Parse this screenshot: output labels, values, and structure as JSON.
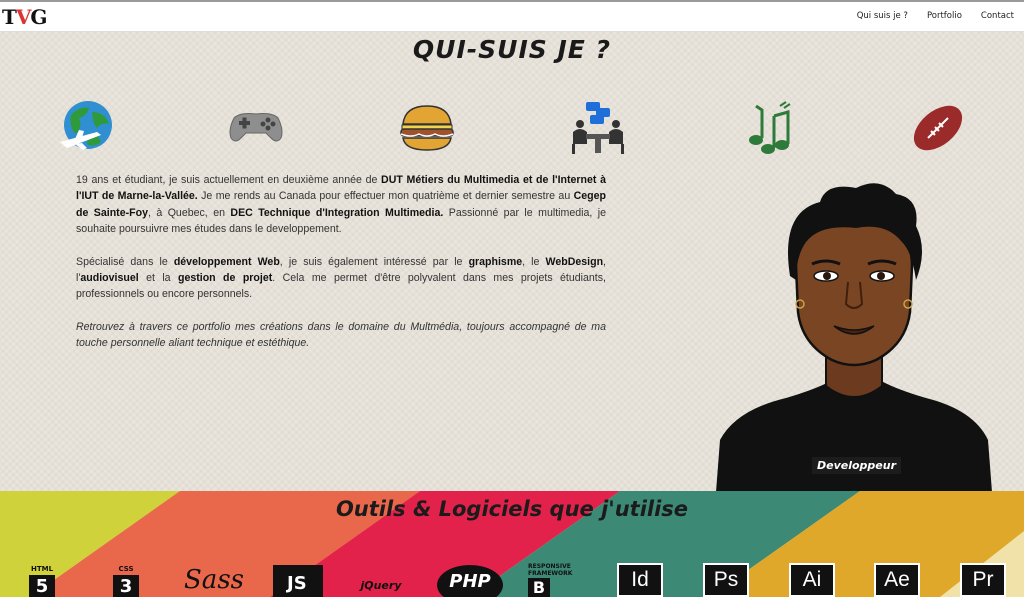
{
  "nav": {
    "logo": "TVG",
    "items": [
      {
        "label": "Qui suis je ?"
      },
      {
        "label": "Portfolio"
      },
      {
        "label": "Contact"
      }
    ]
  },
  "about": {
    "title": "QUI-SUIS JE ?",
    "icons": [
      "globe-plane-icon",
      "gamepad-icon",
      "burger-icon",
      "meeting-icon",
      "music-notes-icon",
      "football-icon"
    ],
    "badge": "Developpeur"
  },
  "bio": {
    "p1": {
      "a": "19 ans et étudiant, je suis actuellement en deuxième année de ",
      "b": "DUT Métiers du Multimedia et de l'Internet à l'IUT de Marne-la-Vallée.",
      "c": " Je me rends au Canada pour effectuer mon quatrième et dernier semestre au ",
      "d": "Cegep de Sainte-Foy",
      "e": ", à Quebec, en ",
      "f": "DEC Technique d'Integration Multimedia.",
      "g": " Passionné par le multimedia, je souhaite poursuivre mes études dans le developpement."
    },
    "p2": {
      "a": "Spécialisé dans le ",
      "b": "développement Web",
      "c": ", je suis également intéressé par le ",
      "d": "graphisme",
      "e": ", le ",
      "f": "WebDesign",
      "g": ", l'",
      "h": "audiovisuel",
      "i": " et la ",
      "j": "gestion de projet",
      "k": ". Cela me permet d'être polyvalent dans mes projets étudiants, professionnels ou encore personnels."
    },
    "p3": "Retrouvez à travers ce portfolio mes créations dans le domaine du Multmédia, toujours accompagné de ma touche personnelle aliant technique et estéthique."
  },
  "tools": {
    "title": "Outils & Logiciels que j'utilise",
    "items": [
      {
        "label": "HTML",
        "glyph": "5"
      },
      {
        "label": "CSS",
        "glyph": "3"
      },
      {
        "label": "",
        "glyph": "Sass"
      },
      {
        "label": "",
        "glyph": "JS"
      },
      {
        "label": "",
        "glyph": "jQuery"
      },
      {
        "label": "",
        "glyph": "PHP"
      },
      {
        "label": "RESPONSIVE FRAMEWORK",
        "glyph": "B"
      },
      {
        "label": "",
        "glyph": "Id"
      },
      {
        "label": "",
        "glyph": "Ps"
      },
      {
        "label": "",
        "glyph": "Ai"
      },
      {
        "label": "",
        "glyph": "Ae"
      },
      {
        "label": "",
        "glyph": "Pr"
      }
    ]
  },
  "colors": {
    "accent": "#d33a2c",
    "stripe_yellow": "#cfd23a",
    "stripe_orange": "#e9674a",
    "stripe_red": "#e3224b",
    "stripe_teal": "#3c8a76",
    "stripe_gold": "#e0a82a"
  }
}
